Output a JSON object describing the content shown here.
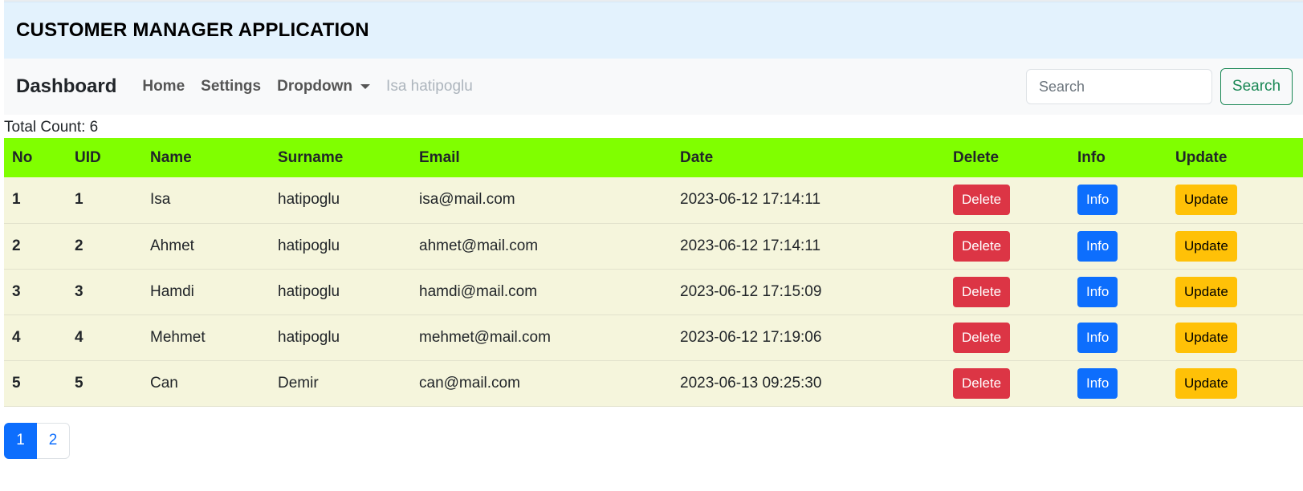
{
  "app": {
    "title": "CUSTOMER MANAGER APPLICATION"
  },
  "navbar": {
    "brand": "Dashboard",
    "links": [
      "Home",
      "Settings"
    ],
    "dropdown_label": "Dropdown",
    "user_label": "Isa hatipoglu",
    "search_placeholder": "Search",
    "search_value": "",
    "search_button": "Search"
  },
  "summary": {
    "total_count_text": "Total Count: 6"
  },
  "table": {
    "headers": [
      "No",
      "UID",
      "Name",
      "Surname",
      "Email",
      "Date",
      "Delete",
      "Info",
      "Update"
    ],
    "rows": [
      {
        "no": "1",
        "uid": "1",
        "name": "Isa",
        "surname": "hatipoglu",
        "email": "isa@mail.com",
        "date": "2023-06-12 17:14:11",
        "delete": "Delete",
        "info": "Info",
        "update": "Update"
      },
      {
        "no": "2",
        "uid": "2",
        "name": "Ahmet",
        "surname": "hatipoglu",
        "email": "ahmet@mail.com",
        "date": "2023-06-12 17:14:11",
        "delete": "Delete",
        "info": "Info",
        "update": "Update"
      },
      {
        "no": "3",
        "uid": "3",
        "name": "Hamdi",
        "surname": "hatipoglu",
        "email": "hamdi@mail.com",
        "date": "2023-06-12 17:15:09",
        "delete": "Delete",
        "info": "Info",
        "update": "Update"
      },
      {
        "no": "4",
        "uid": "4",
        "name": "Mehmet",
        "surname": "hatipoglu",
        "email": "mehmet@mail.com",
        "date": "2023-06-12 17:19:06",
        "delete": "Delete",
        "info": "Info",
        "update": "Update"
      },
      {
        "no": "5",
        "uid": "5",
        "name": "Can",
        "surname": "Demir",
        "email": "can@mail.com",
        "date": "2023-06-13 09:25:30",
        "delete": "Delete",
        "info": "Info",
        "update": "Update"
      }
    ]
  },
  "pagination": {
    "pages": [
      "1",
      "2"
    ],
    "active": "1"
  },
  "colors": {
    "header_bg": "#e3f2fd",
    "navbar_bg": "#f8f9fa",
    "table_header_bg": "#80ff00",
    "row_bg": "#f5f5dc",
    "delete": "#dc3545",
    "info": "#0d6efd",
    "update": "#ffc107",
    "search_btn": "#198754"
  },
  "icons": {
    "dropdown_caret": "chevron-down-icon"
  }
}
